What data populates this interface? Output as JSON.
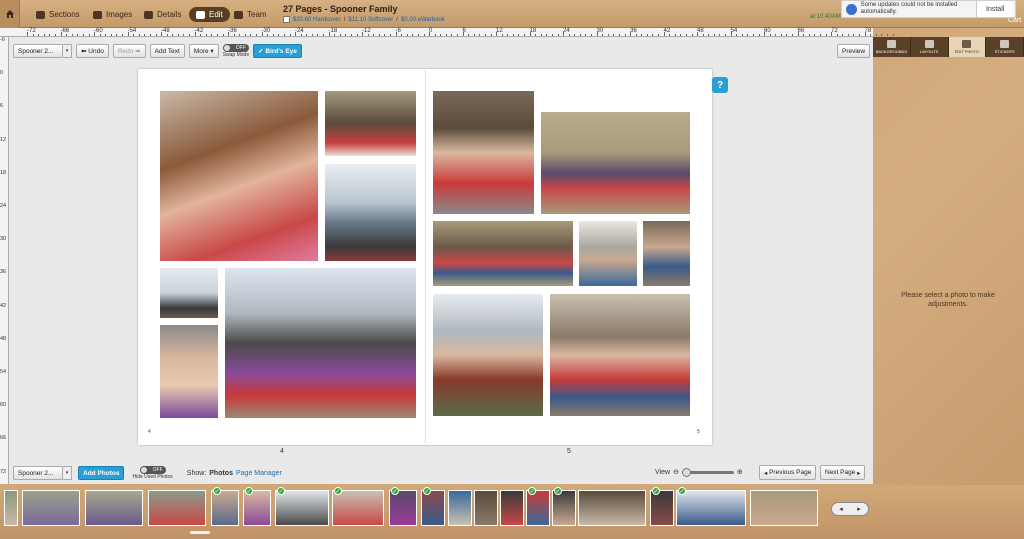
{
  "topbar": {
    "tabs": [
      {
        "label": "Sections",
        "icon": "sections-icon"
      },
      {
        "label": "Images",
        "icon": "camera-icon"
      },
      {
        "label": "Details",
        "icon": "tag-icon"
      },
      {
        "label": "Edit",
        "icon": "pencil-icon",
        "active": true
      },
      {
        "label": "Team",
        "icon": "team-icon"
      }
    ],
    "project_title": "27 Pages - Spooner Family",
    "pricing": [
      "$20.60 Hardcover",
      "$11.10 Softcover",
      "$0.00 eWarbook"
    ],
    "time_text": "at 10:40AM at 1",
    "cart_label": "Cart"
  },
  "notification": {
    "text": "Some updates could not be installed automatically.",
    "button": "Install"
  },
  "ruler": {
    "top_labels": [
      "-72",
      "-66",
      "-60",
      "-54",
      "-48",
      "-42",
      "-36",
      "-30",
      "-24",
      "-18",
      "-12",
      "-6",
      "0",
      "6",
      "12",
      "18",
      "24",
      "30",
      "36",
      "42",
      "48",
      "54",
      "60",
      "66",
      "72",
      "78"
    ],
    "left_labels": [
      "-6",
      "0",
      "6",
      "12",
      "18",
      "24",
      "30",
      "36",
      "42",
      "48",
      "54",
      "60",
      "66",
      "72"
    ]
  },
  "toolbar": {
    "layout_select": "Spooner 2...",
    "undo": "Undo",
    "redo": "Redo",
    "add_text": "Add Text",
    "more": "More",
    "swap_toggle": "OFF",
    "swap_label": "Swap Mode",
    "birds_eye": "Bird's Eye",
    "preview": "Preview"
  },
  "spread": {
    "left_page_number": "4",
    "right_page_number": "5",
    "left_corner_num": "4",
    "right_corner_num": "5",
    "help": "?"
  },
  "bottom": {
    "album_select": "Spooner 2...",
    "add_photos": "Add Photos",
    "hide_toggle": "OFF",
    "hide_label": "Hide Used Photos",
    "show_label": "Show:",
    "show_photos": "Photos",
    "show_manager": "Page Manager",
    "view_label": "View",
    "prev_page": "Previous Page",
    "next_page": "Next Page"
  },
  "right_panel": {
    "tabs": [
      "BACKGROUNDS",
      "LAYOUTS",
      "EDIT PHOTO",
      "STICKERS"
    ],
    "active_tab": "EDIT PHOTO",
    "message": "Please select a photo to make adjustments."
  },
  "filmstrip": {
    "nav_prev": "◂",
    "nav_next": "▸"
  }
}
